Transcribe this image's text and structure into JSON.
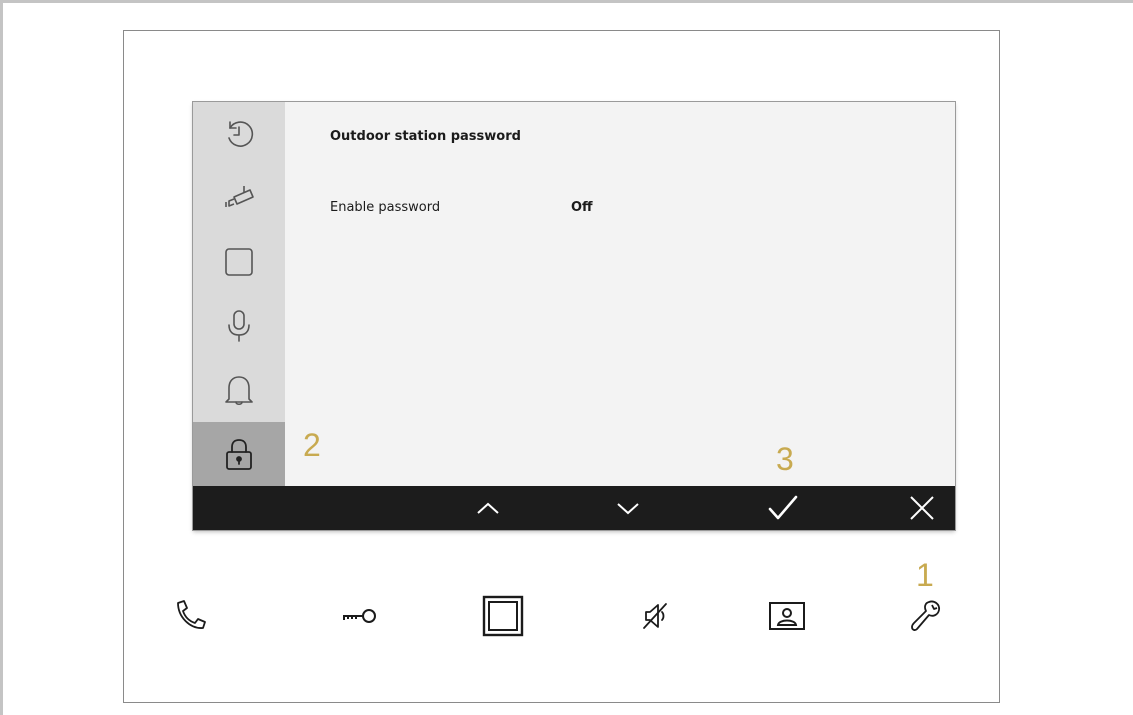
{
  "page": {
    "title": "Outdoor station password"
  },
  "settings": {
    "rows": [
      {
        "label": "Enable password",
        "value": "Off"
      }
    ]
  },
  "sidebar": {
    "items": [
      {
        "icon": "history-icon"
      },
      {
        "icon": "camera-icon"
      },
      {
        "icon": "square-icon"
      },
      {
        "icon": "microphone-icon"
      },
      {
        "icon": "bell-icon"
      },
      {
        "icon": "lock-icon",
        "active": true
      }
    ]
  },
  "bottom_bar": {
    "buttons": [
      {
        "icon": "chevron-up-icon"
      },
      {
        "icon": "chevron-down-icon"
      },
      {
        "icon": "check-icon"
      },
      {
        "icon": "close-icon"
      }
    ]
  },
  "callouts": {
    "one": "1",
    "two": "2",
    "three": "3"
  },
  "hardware_buttons": [
    {
      "icon": "phone-icon"
    },
    {
      "icon": "key-icon"
    },
    {
      "icon": "frame-icon"
    },
    {
      "icon": "mute-icon"
    },
    {
      "icon": "contact-icon"
    },
    {
      "icon": "wrench-icon"
    }
  ],
  "colors": {
    "callout": "#c8aa50",
    "sidebar_bg": "#dadada",
    "sidebar_active": "#a6a6a6",
    "screen_bg": "#f3f3f3",
    "bar_bg": "#1c1c1c"
  }
}
